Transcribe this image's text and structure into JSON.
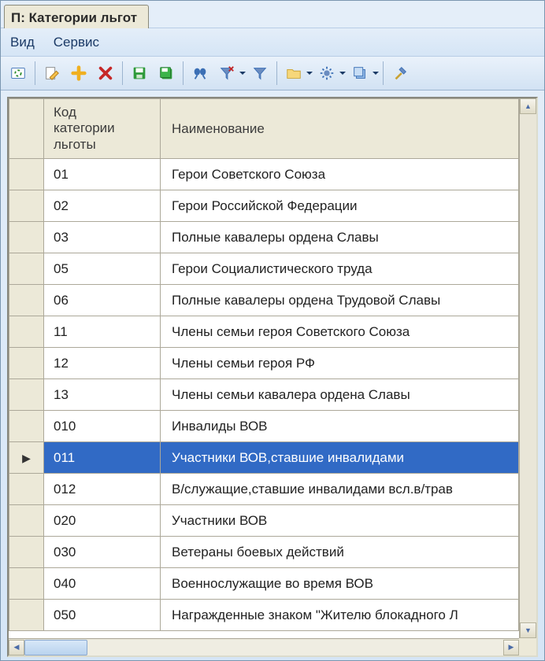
{
  "tab_title": "П: Категории льгот",
  "menu": {
    "view": "Вид",
    "service": "Сервис"
  },
  "columns": {
    "code": "Код\nкатегории\nльготы",
    "name": "Наименование"
  },
  "selected_index": 9,
  "rows": [
    {
      "code": "01",
      "name": "Герои Советского Союза"
    },
    {
      "code": "02",
      "name": "Герои Российской Федерации"
    },
    {
      "code": "03",
      "name": "Полные кавалеры ордена Славы"
    },
    {
      "code": "05",
      "name": "Герои Социалистического труда"
    },
    {
      "code": "06",
      "name": "Полные кавалеры ордена Трудовой Славы"
    },
    {
      "code": "11",
      "name": "Члены семьи героя Советского Союза"
    },
    {
      "code": "12",
      "name": "Члены семьи героя РФ"
    },
    {
      "code": "13",
      "name": "Члены семьи кавалера ордена Славы"
    },
    {
      "code": "010",
      "name": "Инвалиды ВОВ"
    },
    {
      "code": "011",
      "name": "Участники ВОВ,ставшие инвалидами"
    },
    {
      "code": "012",
      "name": "В/служащие,ставшие инвалидами  всл.в/трав"
    },
    {
      "code": "020",
      "name": "Участники ВОВ"
    },
    {
      "code": "030",
      "name": "Ветераны боевых действий"
    },
    {
      "code": "040",
      "name": "Военнослужащие во время ВОВ"
    },
    {
      "code": "050",
      "name": "Награжденные знаком \"Жителю блокадного Л"
    }
  ]
}
